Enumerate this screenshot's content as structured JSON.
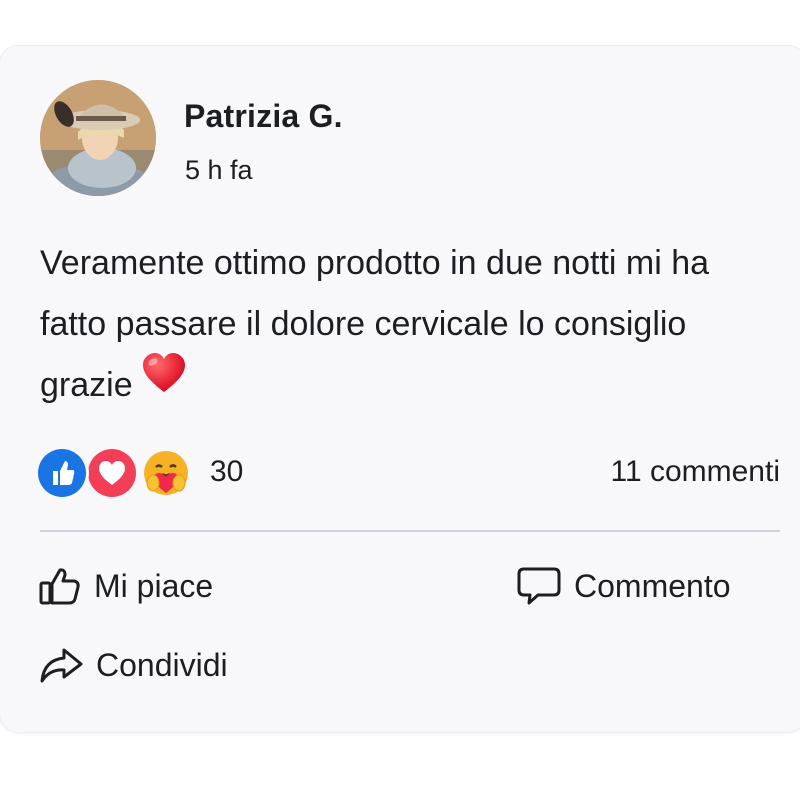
{
  "post": {
    "author": "Patrizia G.",
    "time": "5 h fa",
    "body": "Veramente ottimo prodotto in due notti mi ha fatto passare il dolore cervicale lo consiglio grazie",
    "body_emoji": "red-heart-icon"
  },
  "stats": {
    "reactions": [
      "like-reaction-icon",
      "love-reaction-icon",
      "care-reaction-icon"
    ],
    "reaction_count": "30",
    "comment_count": "11 commenti"
  },
  "actions": {
    "like_label": "Mi piace",
    "comment_label": "Commento",
    "share_label": "Condividi"
  },
  "colors": {
    "like_blue": "#1b74e4",
    "love_red": "#f33e58",
    "care_yellow": "#f7b125",
    "divider": "#d2d2dc"
  }
}
